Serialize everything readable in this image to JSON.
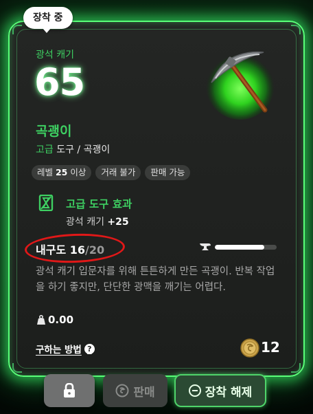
{
  "equip_tag": "장착 중",
  "stat": {
    "label": "광석 캐기",
    "value": "65"
  },
  "item": {
    "name": "곡괭이",
    "grade": "고급",
    "type_rest": " 도구 / 곡괭이",
    "icon": "pickaxe-icon"
  },
  "chips": [
    {
      "prefix": "레벨 ",
      "bold": "25",
      "suffix": " 이상"
    },
    {
      "prefix": "거래 불가",
      "bold": "",
      "suffix": ""
    },
    {
      "prefix": "판매 가능",
      "bold": "",
      "suffix": ""
    }
  ],
  "effect": {
    "title": "고급 도구 효과",
    "desc_prefix": "광석 캐기 ",
    "desc_bold": "+25"
  },
  "durability": {
    "label": "내구도 ",
    "current": "16",
    "sep": "/",
    "max": "20",
    "fraction": 0.8
  },
  "description": "광석 캐기 입문자를 위해 튼튼하게 만든 곡괭이. 반복 작업을 하기 좋지만, 단단한 광맥을 깨기는 어렵다.",
  "weight": "0.00",
  "how_to": "구하는 방법",
  "price": "12",
  "buttons": {
    "sell": "판매",
    "unequip": "장착 해제"
  },
  "colors": {
    "accent_green": "#3ed062",
    "glow_green": "#59ff78",
    "highlight_red": "#e01818"
  }
}
